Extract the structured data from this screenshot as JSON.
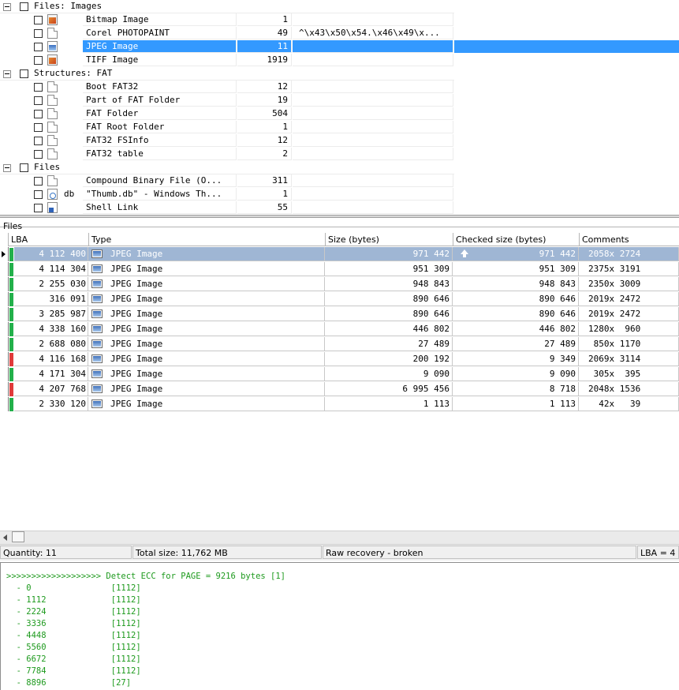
{
  "tree": {
    "groups": [
      {
        "label": "Files: Images",
        "items": [
          {
            "name": "Bitmap Image",
            "count": "1",
            "extra": "",
            "icon": "paint-icon"
          },
          {
            "name": "Corel PHOTOPAINT",
            "count": "49",
            "extra": "^\\x43\\x50\\x54.\\x46\\x49\\x...",
            "icon": "document-icon"
          },
          {
            "name": "JPEG Image",
            "count": "11",
            "extra": "",
            "icon": "picture-icon",
            "selected": true
          },
          {
            "name": "TIFF Image",
            "count": "1919",
            "extra": "",
            "icon": "paint-icon"
          }
        ]
      },
      {
        "label": "Structures: FAT",
        "items": [
          {
            "name": "Boot FAT32",
            "count": "12",
            "extra": "",
            "icon": "document-icon"
          },
          {
            "name": "Part of FAT Folder",
            "count": "19",
            "extra": "",
            "icon": "document-icon"
          },
          {
            "name": "FAT Folder",
            "count": "504",
            "extra": "",
            "icon": "document-icon"
          },
          {
            "name": "FAT Root Folder",
            "count": "1",
            "extra": "",
            "icon": "document-icon"
          },
          {
            "name": "FAT32 FSInfo",
            "count": "12",
            "extra": "",
            "icon": "document-icon"
          },
          {
            "name": "FAT32 table",
            "count": "2",
            "extra": "",
            "icon": "document-icon"
          }
        ]
      },
      {
        "label": "Files",
        "items": [
          {
            "name": "Compound Binary File (O...",
            "count": "311",
            "extra": "",
            "icon": "document-icon"
          },
          {
            "name": "\"Thumb.db\" - Windows Th...",
            "count": "1",
            "extra": "",
            "icon": "database-icon",
            "tag": "db"
          },
          {
            "name": "Shell Link",
            "count": "55",
            "extra": "",
            "icon": "shortcut-icon"
          }
        ]
      }
    ]
  },
  "files_panel": {
    "caption": "Files",
    "columns": [
      "LBA",
      "Type",
      "Size (bytes)",
      "Checked size (bytes)",
      "Comments"
    ],
    "rows": [
      {
        "lba": "4 112 400",
        "type": "JPEG Image",
        "size": "971 442",
        "checked": "971 442",
        "comment": "2058x 2724",
        "status_color": "#22b04a",
        "selected": true,
        "current": true
      },
      {
        "lba": "4 114 304",
        "type": "JPEG Image",
        "size": "951 309",
        "checked": "951 309",
        "comment": "2375x 3191",
        "status_color": "#22b04a"
      },
      {
        "lba": "2 255 030",
        "type": "JPEG Image",
        "size": "948 843",
        "checked": "948 843",
        "comment": "2350x 3009",
        "status_color": "#22b04a"
      },
      {
        "lba": "316 091",
        "type": "JPEG Image",
        "size": "890 646",
        "checked": "890 646",
        "comment": "2019x 2472",
        "status_color": "#22b04a"
      },
      {
        "lba": "3 285 987",
        "type": "JPEG Image",
        "size": "890 646",
        "checked": "890 646",
        "comment": "2019x 2472",
        "status_color": "#22b04a"
      },
      {
        "lba": "4 338 160",
        "type": "JPEG Image",
        "size": "446 802",
        "checked": "446 802",
        "comment": "1280x  960",
        "status_color": "#22b04a"
      },
      {
        "lba": "2 688 080",
        "type": "JPEG Image",
        "size": "27 489",
        "checked": "27 489",
        "comment": " 850x 1170",
        "status_color": "#22b04a"
      },
      {
        "lba": "4 116 168",
        "type": "JPEG Image",
        "size": "200 192",
        "checked": "9 349",
        "comment": "2069x 3114",
        "status_color": "#e03a3a"
      },
      {
        "lba": "4 171 304",
        "type": "JPEG Image",
        "size": "9 090",
        "checked": "9 090",
        "comment": " 305x  395",
        "status_color": "#22b04a"
      },
      {
        "lba": "4 207 768",
        "type": "JPEG Image",
        "size": "6 995 456",
        "checked": "8 718",
        "comment": "2048x 1536",
        "status_color": "#e03a3a"
      },
      {
        "lba": "2 330 120",
        "type": "JPEG Image",
        "size": "1 113",
        "checked": "1 113",
        "comment": "  42x   39",
        "status_color": "#22b04a"
      }
    ]
  },
  "status_bar": {
    "quantity": "Quantity: 11",
    "total_size": "Total size: 11,762 MB",
    "mode": "Raw recovery - broken",
    "lba": "LBA =   4"
  },
  "log": {
    "lines": [
      ">>>>>>>>>>>>>>>>>>> Detect ECC for PAGE = 9216 bytes [1]",
      "  - 0                [1112]",
      "  - 1112             [1112]",
      "  - 2224             [1112]",
      "  - 3336             [1112]",
      "  - 4448             [1112]",
      "  - 5560             [1112]",
      "  - 6672             [1112]",
      "  - 7784             [1112]",
      "  - 8896             [27]"
    ]
  }
}
